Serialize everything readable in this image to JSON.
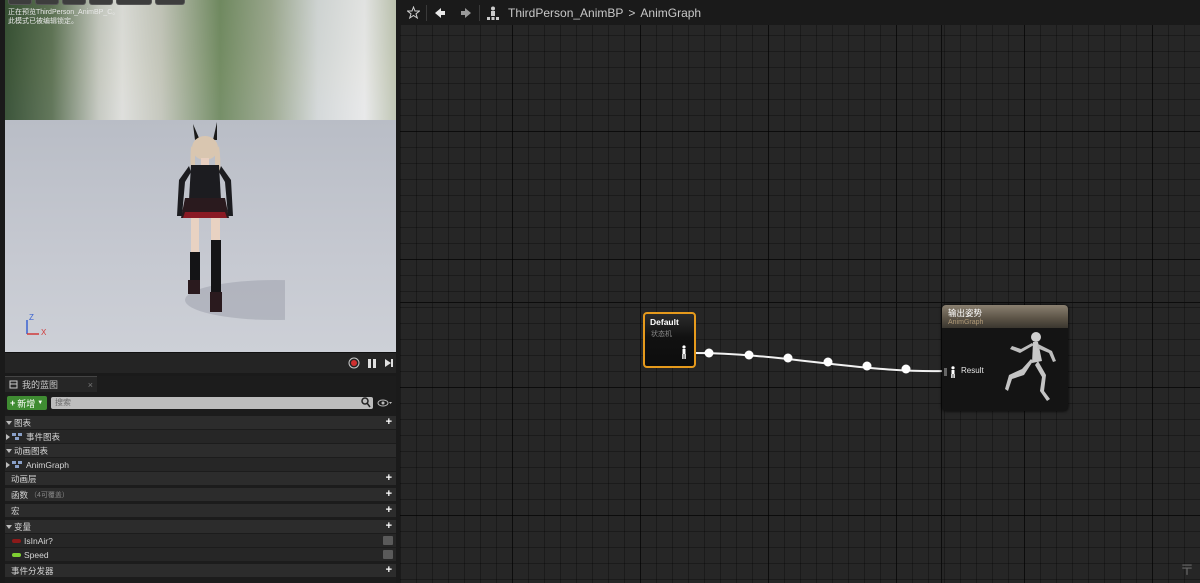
{
  "viewport": {
    "info_line1": "正在预览ThirdPerson_AnimBP_C。",
    "info_line2": "此模式已被编辑锁定。",
    "axis_z": "Z",
    "axis_x": "X"
  },
  "panel": {
    "tab_label": "我的蓝图",
    "add_label": "新增",
    "search_placeholder": "搜索",
    "rows": {
      "graphs": "图表",
      "event_graph": "事件图表",
      "anim_graphs": "动画图表",
      "anim_graph": "AnimGraph",
      "anim_layers": "动画层",
      "functions": "函数",
      "functions_override": "（4可覆盖）",
      "macros": "宏",
      "variables": "变量",
      "var_isinair": "IsInAir?",
      "var_speed": "Speed",
      "event_dispatchers": "事件分发器"
    }
  },
  "breadcrumb": {
    "blueprint": "ThirdPerson_AnimBP",
    "separator": ">",
    "graph": "AnimGraph"
  },
  "nodes": {
    "default": {
      "title": "Default",
      "subtitle": "状态机"
    },
    "output": {
      "title": "输出姿势",
      "subtitle": "AnimGraph",
      "pin_label": "Result"
    }
  },
  "colors": {
    "add_button": "#3f8c32",
    "state_node_border": "#e69a1c",
    "isinair_pin": "#8c1a1a",
    "speed_pin": "#7ecf32"
  }
}
